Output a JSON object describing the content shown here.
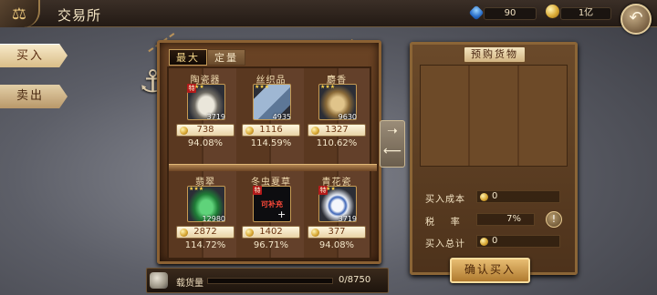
{
  "header": {
    "title": "交易所",
    "gems": "90",
    "coins": "1亿"
  },
  "sidebar": {
    "buy_label": "买入",
    "sell_label": "卖出"
  },
  "shelf": {
    "tabs": [
      "最大",
      "定量"
    ],
    "items": [
      {
        "name": "陶瓷器",
        "stock": "3719",
        "price": "738",
        "ratio": "94.08%",
        "special": true,
        "stars": "★★",
        "color": "#d7d2c4"
      },
      {
        "name": "丝织品",
        "stock": "4935",
        "price": "1116",
        "ratio": "114.59%",
        "special": false,
        "stars": "★★★",
        "color": "#7d97b5"
      },
      {
        "name": "麝香",
        "stock": "9630",
        "price": "1327",
        "ratio": "110.62%",
        "special": false,
        "stars": "★★★",
        "color": "#c5a56a"
      },
      {
        "name": "翡翠",
        "stock": "12980",
        "price": "2872",
        "ratio": "114.72%",
        "special": false,
        "stars": "★★★",
        "color": "#2e9a4a"
      },
      {
        "name": "冬虫夏草",
        "stock": "",
        "price": "1402",
        "ratio": "96.71%",
        "special": true,
        "stars": "",
        "overlay": "可补充",
        "color": "#141416"
      },
      {
        "name": "青花瓷",
        "stock": "3719",
        "price": "377",
        "ratio": "94.08%",
        "special": true,
        "stars": "★★",
        "color": "#e6ecf4"
      }
    ]
  },
  "capacity": {
    "label": "载货量",
    "value": "0/8750",
    "fill_fraction": 0
  },
  "panel": {
    "title": "预购货物",
    "buy_cost_label": "买入成本",
    "buy_cost_value": "0",
    "tax_label": "税    率",
    "tax_value": "7%",
    "total_label": "买入总计",
    "total_value": "0",
    "tax_info_icon": "!",
    "confirm_label": "确认买入"
  }
}
